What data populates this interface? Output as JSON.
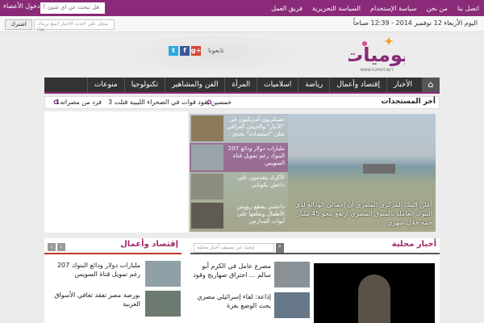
{
  "top": {
    "nav": [
      "اتصل بنا",
      "من نحن",
      "سياسة الإستخدام",
      "السياسة التحريرية",
      "فريق العمل"
    ],
    "question": "هل تبحث عن اي شيئ ؟",
    "login": "دخول الأعضاء",
    "date": "اليوم الأربعاء 12 نوفمبر 2014 - 12:39 صباحاً",
    "subscribe_placeholder": "سجل علي احدث الاخبار (سع بريدك هنا)",
    "subscribe_btn": "اشترك"
  },
  "header": {
    "follow": "تابعونا",
    "logo_text": "يوميات",
    "logo_url": "WWW.YUPRAT.NET",
    "social": [
      {
        "name": "twitter",
        "label": "t",
        "color": "#2aa9e0"
      },
      {
        "name": "facebook",
        "label": "f",
        "color": "#3b5998"
      },
      {
        "name": "googleplus",
        "label": "g+",
        "color": "#d34836"
      }
    ]
  },
  "nav": [
    "الأخبار",
    "إقتصاد وأعمال",
    "رياضة",
    "اسلاميات",
    "المرأة",
    "الفن والمشاهير",
    "تكنولوجيا",
    "منوعات"
  ],
  "ticker": {
    "label": "أخر المستجدات",
    "items": [
      "خمسين يقود قوات في الصحراء الليبية قتلت 3",
      "1فرد من مصراته"
    ]
  },
  "slider": {
    "thumbs": [
      "عسكريون أمريكيون في \"الأنبار\" والجيش العراقي يعلن \"استعداده\" بحدى",
      "207 مليارات دولار ودائع البنوك رغم تمويل قناة السويس",
      "الأكراد يتقدمون على داعش بكوباني",
      "داعشي يقطع رؤوس الأطفال ويعلقها على أبواب المدارس"
    ],
    "caption": "أعلن البنك المركزي المصري أن إجمالي الودائع لدى البنوك العاملة بالسوق المصري ارتفع بنحو 45 مليار جنيه خلال شهري"
  },
  "local": {
    "title": "أخبار محلية",
    "search_placeholder": "إبحث عن تصنيف أخبار محلية",
    "items": [
      "مصرع عامل في الكرم أبو سالم ... احتراق صهاريج وقود",
      "إذاعة: لقاء إسرائيلي مصري بحث الوضع بغزة"
    ]
  },
  "economy": {
    "title": "إقتصاد وأعمال",
    "items": [
      "207 مليارات دولار ودائع البنوك رغم تمويل قناة السويس",
      "بورصة مصر تفقد تعافي الأسواق العربية"
    ]
  }
}
